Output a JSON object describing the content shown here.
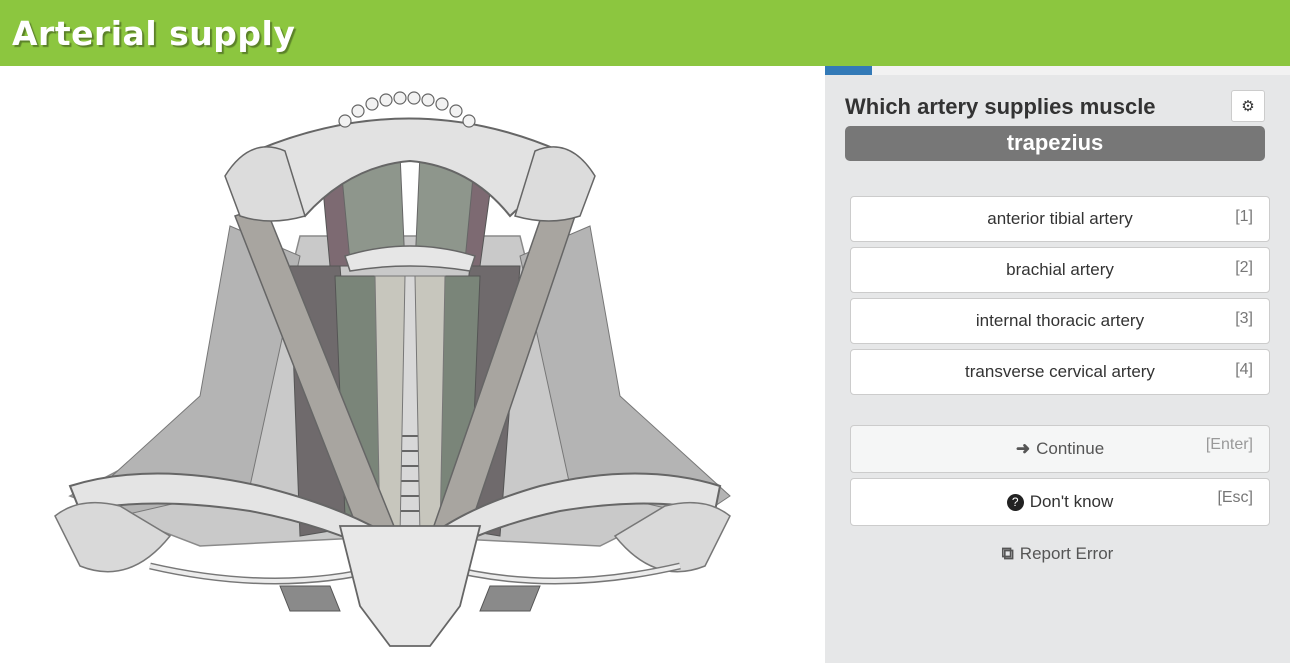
{
  "header": {
    "title": "Arterial supply"
  },
  "progress": {
    "fraction": 0.1
  },
  "question": {
    "prompt": "Which artery supplies muscle",
    "subject": "trapezius",
    "settings_icon": "gear-icon"
  },
  "answers": [
    {
      "label": "anterior tibial artery",
      "key": "[1]"
    },
    {
      "label": "brachial artery",
      "key": "[2]"
    },
    {
      "label": "internal thoracic artery",
      "key": "[3]"
    },
    {
      "label": "transverse cervical artery",
      "key": "[4]"
    }
  ],
  "actions": {
    "continue_label": "Continue",
    "continue_key": "[Enter]",
    "dontknow_label": "Don't know",
    "dontknow_key": "[Esc]",
    "report_label": "Report Error"
  },
  "colors": {
    "header": "#8cc63f",
    "progress": "#337ab7",
    "subject_bg": "#777777",
    "panel_bg": "#e6e7e8"
  }
}
